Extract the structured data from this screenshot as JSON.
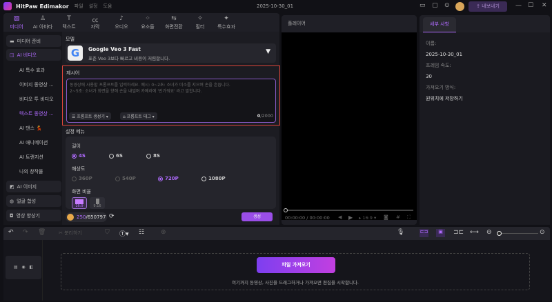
{
  "app": {
    "name": "HitPaw Edimakor",
    "menus": [
      "파일",
      "설정",
      "도움"
    ],
    "project_title": "2025-10-30_01",
    "export_label": "내보내기"
  },
  "tabs": [
    {
      "label": "미디어",
      "icon": "media-icon"
    },
    {
      "label": "AI 아바타",
      "icon": "avatar-icon"
    },
    {
      "label": "텍스트",
      "icon": "text-icon"
    },
    {
      "label": "자막",
      "icon": "caption-icon"
    },
    {
      "label": "오디오",
      "icon": "music-icon"
    },
    {
      "label": "요소들",
      "icon": "elements-icon"
    },
    {
      "label": "화면전환",
      "icon": "transition-icon"
    },
    {
      "label": "필터",
      "icon": "filter-icon"
    },
    {
      "label": "특수효과",
      "icon": "effects-icon"
    }
  ],
  "sidebar": {
    "items": [
      {
        "label": "미디어 준비"
      },
      {
        "label": "AI 비디오"
      },
      {
        "label": "AI 특수 효과"
      },
      {
        "label": "이미지 동영상 ..."
      },
      {
        "label": "비디오 투 비디오"
      },
      {
        "label": "텍스트 동영상 ..."
      },
      {
        "label": "AI 댄스 💃"
      },
      {
        "label": "AI 애니메이션"
      },
      {
        "label": "AI 트랜지션"
      },
      {
        "label": "나의 창작물"
      },
      {
        "label": "AI 이미지"
      },
      {
        "label": "얼굴 합성"
      },
      {
        "label": "영상 향상기"
      }
    ]
  },
  "model": {
    "section": "모델",
    "name": "Google Veo 3 Fast",
    "desc": "표준 Veo 3보다 빠르고 비용이 저렴합니다."
  },
  "prompt": {
    "section": "제시어",
    "placeholder": "동영상에 사용할 프롬프트를 입력하세요. 예시: 0~2초: 소녀가 미소를 지으며 손을 흔듭니다.",
    "placeholder2": "2~5초: 소녀가 화면을 향해 손을 내밀며 카메라에 '반가워요' 라고 말합니다.",
    "generator": "프롬프트 생성기",
    "tags": "프롬프트 태그",
    "count": "0",
    "max": "/2000"
  },
  "settings": {
    "section": "설정 메뉴",
    "length_label": "길이",
    "lengths": [
      "4S",
      "6S",
      "8S"
    ],
    "length_selected": "4S",
    "res_label": "해상도",
    "resolutions": [
      "360P",
      "540P",
      "720P",
      "1080P"
    ],
    "res_selected": "720P",
    "ratio_label": "화면 비율",
    "ratios": [
      "16:9",
      "9:16"
    ]
  },
  "credits": {
    "used": "250",
    "total": "/650797"
  },
  "generate_label": "생성",
  "player": {
    "title": "플레이어",
    "time": "00:00:00",
    "duration": "/ 00:00:00",
    "ratio": "16:9"
  },
  "details": {
    "tab": "세부 사항",
    "name_label": "이름:",
    "name": "2025-10-30_01",
    "fps_label": "프레임 속도:",
    "fps": "30",
    "import_label": "가져오기 방식:",
    "import_mode": "원위치에 저장하기"
  },
  "timeline": {
    "split_label": "분리하기",
    "import_button": "파일 가져오기",
    "hint": "여기까지 동영상, 사진을 드래그하거나 가져오면 편집을 시작합니다."
  },
  "colors": {
    "accent": "#b06bff",
    "highlight_border": "#e2463a"
  }
}
